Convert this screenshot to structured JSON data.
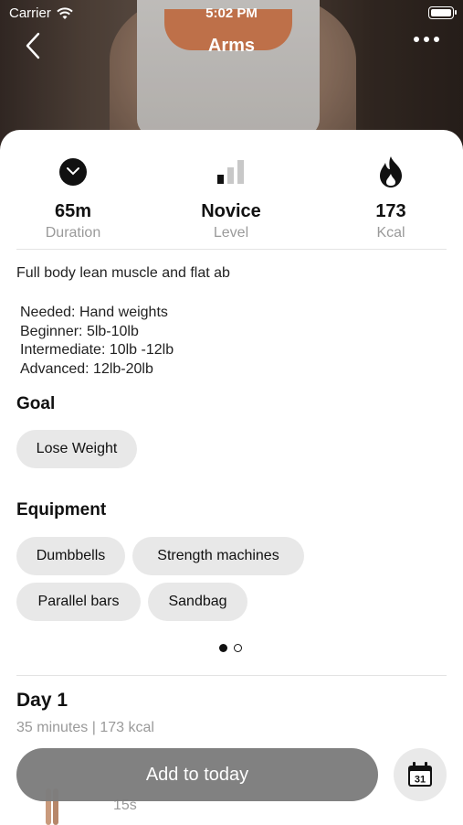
{
  "status_bar": {
    "carrier": "Carrier",
    "time": "5:02 PM"
  },
  "nav": {
    "title": "Arms",
    "back_icon": "chevron-left-icon",
    "more_icon": "more-dots-icon"
  },
  "stats": [
    {
      "icon": "clock-icon",
      "value": "65m",
      "label": "Duration"
    },
    {
      "icon": "signal-bars-icon",
      "value": "Novice",
      "label": "Level"
    },
    {
      "icon": "flame-icon",
      "value": "173",
      "label": "Kcal"
    }
  ],
  "description": "Full body lean muscle and flat ab",
  "needed_lines": [
    "Needed: Hand weights",
    "Beginner: 5lb-10lb",
    "Intermediate: 10lb -12lb",
    "Advanced: 12lb-20lb"
  ],
  "goal": {
    "title": "Goal",
    "chips": [
      "Lose Weight"
    ]
  },
  "equipment": {
    "title": "Equipment",
    "chips": [
      "Dumbbells",
      "Strength machines",
      "Parallel bars",
      "Sandbag"
    ]
  },
  "pager": {
    "total": 2,
    "active": 1
  },
  "day": {
    "title": "Day 1",
    "subtitle": "35 minutes | 173 kcal"
  },
  "exercise_preview": {
    "duration": "15s"
  },
  "actions": {
    "add_label": "Add to today",
    "calendar_day": "31",
    "calendar_icon": "calendar-icon"
  },
  "colors": {
    "add_button": "#7d7d7d",
    "chip_bg": "#e8e8e8",
    "muted_text": "#9a9a9a"
  }
}
